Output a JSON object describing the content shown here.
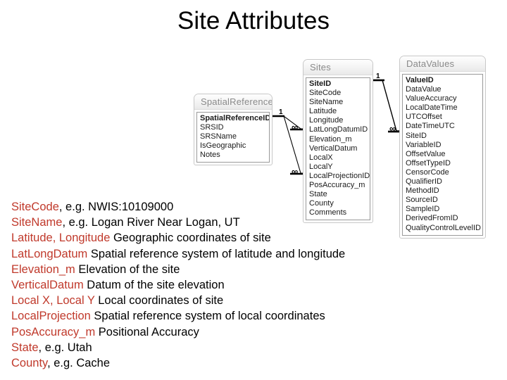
{
  "slide": {
    "title": "Site Attributes"
  },
  "diagram": {
    "type": "entity-relationship",
    "tables": [
      {
        "id": "spatialreferences",
        "name": "SpatialReferences",
        "fields": [
          {
            "name": "SpatialReferenceID",
            "primary_key": true
          },
          {
            "name": "SRSID",
            "primary_key": false
          },
          {
            "name": "SRSName",
            "primary_key": false
          },
          {
            "name": "IsGeographic",
            "primary_key": false
          },
          {
            "name": "Notes",
            "primary_key": false
          }
        ]
      },
      {
        "id": "sites",
        "name": "Sites",
        "fields": [
          {
            "name": "SiteID",
            "primary_key": true
          },
          {
            "name": "SiteCode",
            "primary_key": false
          },
          {
            "name": "SiteName",
            "primary_key": false
          },
          {
            "name": "Latitude",
            "primary_key": false
          },
          {
            "name": "Longitude",
            "primary_key": false
          },
          {
            "name": "LatLongDatumID",
            "primary_key": false
          },
          {
            "name": "Elevation_m",
            "primary_key": false
          },
          {
            "name": "VerticalDatum",
            "primary_key": false
          },
          {
            "name": "LocalX",
            "primary_key": false
          },
          {
            "name": "LocalY",
            "primary_key": false
          },
          {
            "name": "LocalProjectionID",
            "primary_key": false
          },
          {
            "name": "PosAccuracy_m",
            "primary_key": false
          },
          {
            "name": "State",
            "primary_key": false
          },
          {
            "name": "County",
            "primary_key": false
          },
          {
            "name": "Comments",
            "primary_key": false
          }
        ]
      },
      {
        "id": "datavalues",
        "name": "DataValues",
        "fields": [
          {
            "name": "ValueID",
            "primary_key": true
          },
          {
            "name": "DataValue",
            "primary_key": false
          },
          {
            "name": "ValueAccuracy",
            "primary_key": false
          },
          {
            "name": "LocalDateTime",
            "primary_key": false
          },
          {
            "name": "UTCOffset",
            "primary_key": false
          },
          {
            "name": "DateTimeUTC",
            "primary_key": false
          },
          {
            "name": "SiteID",
            "primary_key": false
          },
          {
            "name": "VariableID",
            "primary_key": false
          },
          {
            "name": "OffsetValue",
            "primary_key": false
          },
          {
            "name": "OffsetTypeID",
            "primary_key": false
          },
          {
            "name": "CensorCode",
            "primary_key": false
          },
          {
            "name": "QualifierID",
            "primary_key": false
          },
          {
            "name": "MethodID",
            "primary_key": false
          },
          {
            "name": "SourceID",
            "primary_key": false
          },
          {
            "name": "SampleID",
            "primary_key": false
          },
          {
            "name": "DerivedFromID",
            "primary_key": false
          },
          {
            "name": "QualityControlLevelID",
            "primary_key": false
          }
        ]
      }
    ],
    "relationships": [
      {
        "from": "SpatialReferences.SpatialReferenceID",
        "to": "Sites.LatLongDatumID",
        "from_card": "1",
        "to_card": "∞"
      },
      {
        "from": "SpatialReferences.SpatialReferenceID",
        "to": "Sites.LocalProjectionID",
        "from_card": "1",
        "to_card": "∞"
      },
      {
        "from": "Sites.SiteID",
        "to": "DataValues.SiteID",
        "from_card": "1",
        "to_card": "∞"
      }
    ],
    "cardinality_labels": {
      "sr_one": "1",
      "sr_many_1": "∞",
      "sr_many_2": "∞",
      "sites_one": "1",
      "sites_many": "∞"
    }
  },
  "attributes": {
    "accent_color": "#C0392B",
    "lines": [
      {
        "key": "SiteCode",
        "key_suffix": ",",
        "desc": " e.g. NWIS:10109000"
      },
      {
        "key": "SiteName",
        "key_suffix": ",",
        "desc": " e.g. Logan River Near Logan, UT"
      },
      {
        "key": "Latitude, Longitude",
        "key_suffix": "",
        "desc": " Geographic coordinates of site"
      },
      {
        "key": "LatLongDatum",
        "key_suffix": "",
        "desc": " Spatial reference system of latitude and longitude"
      },
      {
        "key": "Elevation_m",
        "key_suffix": "",
        "desc": " Elevation of the site"
      },
      {
        "key": "VerticalDatum",
        "key_suffix": "",
        "desc": " Datum of the site elevation"
      },
      {
        "key": "Local X, Local Y",
        "key_suffix": "",
        "desc": " Local coordinates of site"
      },
      {
        "key": "LocalProjection",
        "key_suffix": "",
        "desc": " Spatial reference system of local coordinates"
      },
      {
        "key": "PosAccuracy_m",
        "key_suffix": "",
        "desc": " Positional Accuracy"
      },
      {
        "key": "State",
        "key_suffix": ",",
        "desc": " e.g. Utah"
      },
      {
        "key": "County",
        "key_suffix": ",",
        "desc": " e.g. Cache"
      }
    ]
  }
}
